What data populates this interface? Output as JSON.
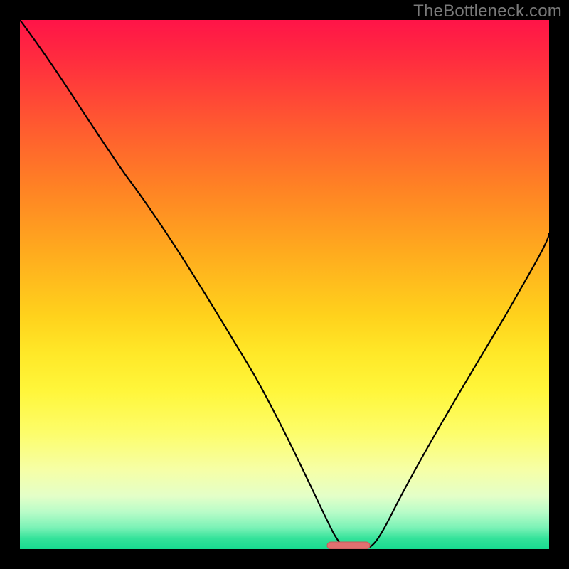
{
  "watermark": "TheBottleneck.com",
  "chart_data": {
    "type": "line",
    "title": "",
    "xlabel": "",
    "ylabel": "",
    "xlim": [
      0,
      100
    ],
    "ylim": [
      0,
      100
    ],
    "grid": false,
    "background": "rainbow-gradient-red-to-green-vertical",
    "series": [
      {
        "name": "bottleneck-curve",
        "x": [
          0,
          5,
          12,
          20,
          30,
          40,
          48,
          54,
          58,
          60,
          62,
          64,
          66,
          70,
          76,
          84,
          92,
          100
        ],
        "y": [
          100,
          92,
          82,
          71,
          57,
          41,
          27,
          14,
          5,
          1,
          0,
          1,
          3,
          10,
          22,
          36,
          48,
          60
        ]
      }
    ],
    "marker": {
      "x_range": [
        58,
        66
      ],
      "y": 0.5,
      "color": "#e07070",
      "shape": "capsule"
    }
  }
}
